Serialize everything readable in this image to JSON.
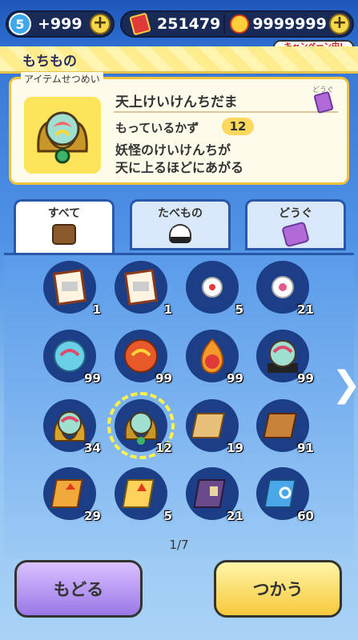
{
  "currency": {
    "level": "5",
    "gems": "+999",
    "points": "251479",
    "money": "9999999",
    "campaign": "キャンペーン中!"
  },
  "header": {
    "title": "もちもの"
  },
  "detail": {
    "section_label": "アイテムせつめい",
    "name": "天上けいけんちだま",
    "count_label": "もっているかず",
    "count": "12",
    "desc_line1": "妖怪のけいけんちが",
    "desc_line2": "天に上るほどにあがる",
    "category": "どうぐ"
  },
  "tabs": [
    {
      "label": "すべて",
      "icon": "bag-icon"
    },
    {
      "label": "たべもの",
      "icon": "rice-ball-icon"
    },
    {
      "label": "どうぐ",
      "icon": "ticket-icon"
    }
  ],
  "items": [
    {
      "icon": "scroll-card",
      "qty": "1"
    },
    {
      "icon": "scroll-card",
      "qty": "1"
    },
    {
      "icon": "white-orb-red",
      "qty": "5"
    },
    {
      "icon": "white-orb-pink",
      "qty": "21"
    },
    {
      "icon": "blue-orb",
      "qty": "99"
    },
    {
      "icon": "red-orb",
      "qty": "99"
    },
    {
      "icon": "flame-orb",
      "qty": "99"
    },
    {
      "icon": "orb-stand",
      "qty": "99"
    },
    {
      "icon": "gold-orb",
      "qty": "34"
    },
    {
      "icon": "heaven-orb",
      "qty": "12"
    },
    {
      "icon": "book-tan",
      "qty": "19"
    },
    {
      "icon": "book-brown",
      "qty": "91"
    },
    {
      "icon": "book-orange",
      "qty": "29"
    },
    {
      "icon": "book-gold",
      "qty": "5"
    },
    {
      "icon": "book-purple",
      "qty": "21"
    },
    {
      "icon": "book-blue",
      "qty": "60"
    }
  ],
  "pagination": "1/7",
  "buttons": {
    "back": "もどる",
    "use": "つかう"
  },
  "colors": {
    "accent": "#f0c33a",
    "selection": "#fff24a"
  }
}
